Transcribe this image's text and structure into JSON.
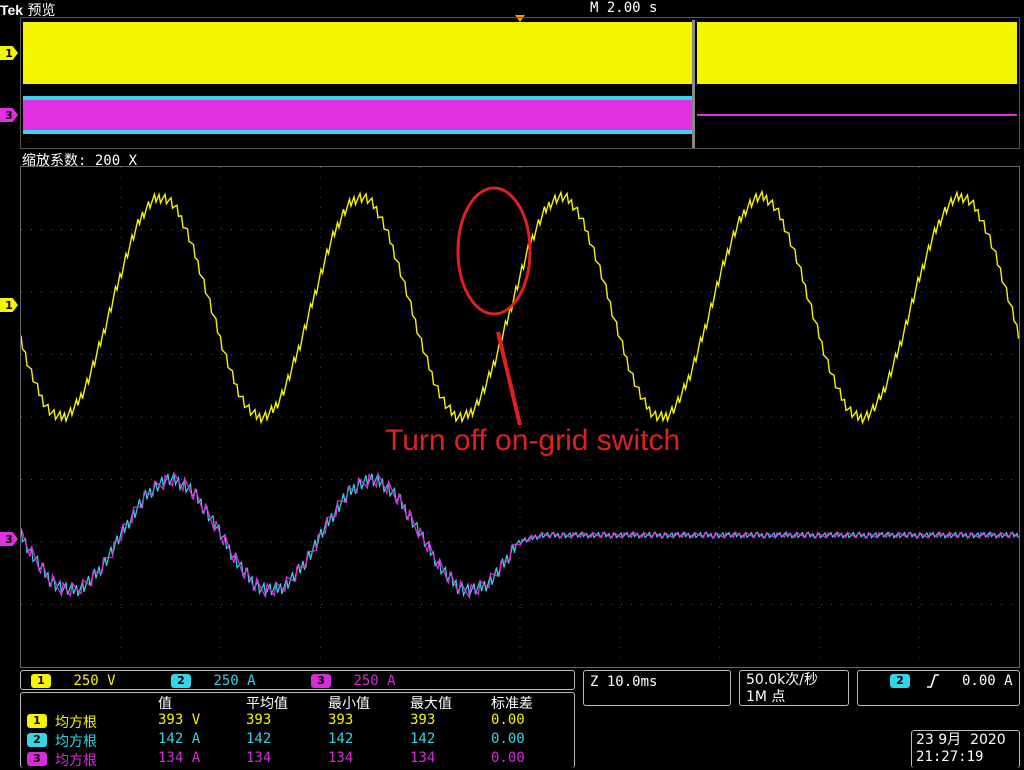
{
  "header": {
    "brand": "Tek",
    "mode": "预览",
    "timebase": "M 2.00 s",
    "zoom": "缩放系数: 200 X"
  },
  "markers": {
    "ch1_overview": "1",
    "ch3_overview": "3",
    "ch1_main": "1",
    "ch3_main": "3"
  },
  "annotation": {
    "text": "Turn off on-grid switch"
  },
  "channels": [
    {
      "num": "1",
      "scale": "250 V",
      "color": "#f5f500"
    },
    {
      "num": "2",
      "scale": "250 A",
      "color": "#33d6e6"
    },
    {
      "num": "3",
      "scale": "250 A",
      "color": "#d62bd6"
    }
  ],
  "horizontal": {
    "zoom_timebase": "Z 10.0ms"
  },
  "acquisition": {
    "rate": "50.0k次/秒",
    "points": "1M 点"
  },
  "trigger": {
    "channel": "2",
    "slope_icon": "rising-edge-icon",
    "level": "0.00 A"
  },
  "datetime": {
    "date": "23 9月  2020",
    "time": "21:27:19"
  },
  "measurements": {
    "headers": [
      "值",
      "平均值",
      "最小值",
      "最大值",
      "标准差"
    ],
    "rows": [
      {
        "ch": "1",
        "label": "均方根",
        "value": "393 V",
        "mean": "393",
        "min": "393",
        "max": "393",
        "std": "0.00",
        "color": "#f5f500"
      },
      {
        "ch": "2",
        "label": "均方根",
        "value": "142 A",
        "mean": "142",
        "min": "142",
        "max": "142",
        "std": "0.00",
        "color": "#33d6e6"
      },
      {
        "ch": "3",
        "label": "均方根",
        "value": "134 A",
        "mean": "134",
        "min": "134",
        "max": "134",
        "std": "0.00",
        "color": "#d62bd6"
      }
    ]
  }
}
